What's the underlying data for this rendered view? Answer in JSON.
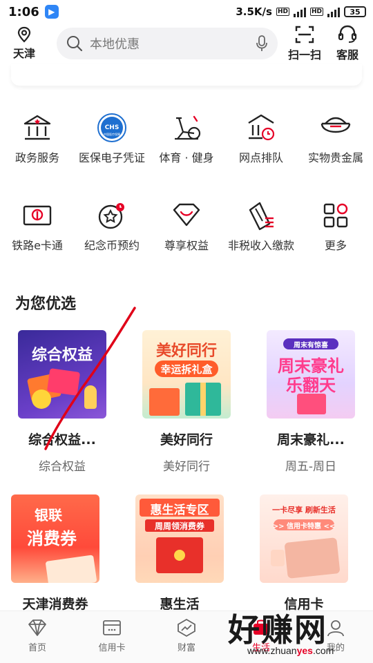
{
  "status_bar": {
    "time": "1:06",
    "speed": "3.5K/s",
    "battery": "35",
    "network": "4G"
  },
  "header": {
    "location": "天津",
    "search_placeholder": "本地优惠",
    "scan_label": "扫一扫",
    "service_label": "客服"
  },
  "services": [
    {
      "label": "政务服务",
      "icon": "government-building-icon"
    },
    {
      "label": "医保电子凭证",
      "icon": "chs-medical-insurance-icon"
    },
    {
      "label": "体育 · 健身",
      "icon": "exercise-bike-icon"
    },
    {
      "label": "网点排队",
      "icon": "branch-queue-icon"
    },
    {
      "label": "实物贵金属",
      "icon": "gold-ingot-icon"
    },
    {
      "label": "铁路e卡通",
      "icon": "railway-card-icon"
    },
    {
      "label": "纪念币预约",
      "icon": "commemorative-coin-icon"
    },
    {
      "label": "尊享权益",
      "icon": "diamond-privilege-icon"
    },
    {
      "label": "非税收入缴款",
      "icon": "tax-payment-icon"
    },
    {
      "label": "更多",
      "icon": "more-grid-icon"
    }
  ],
  "section_title": "为您优选",
  "featured": [
    {
      "title": "综合权益...",
      "sub": "综合权益",
      "thumb_text": "综合权益"
    },
    {
      "title": "美好同行",
      "sub": "美好同行",
      "thumb_text": "美好同行",
      "thumb_sub": "幸运拆礼盒"
    },
    {
      "title": "周末豪礼...",
      "sub": "周五-周日",
      "thumb_text": "周末豪礼",
      "thumb_text2": "乐翻天",
      "thumb_tag": "周末有惊喜"
    }
  ],
  "featured2": [
    {
      "title": "天津消费券",
      "thumb_text": "银联",
      "thumb_text2": "消费券"
    },
    {
      "title": "惠生活",
      "thumb_text": "惠生活专区",
      "thumb_sub": "周周领消费券"
    },
    {
      "title": "信用卡",
      "thumb_text": "一卡尽享 刷新生活",
      "thumb_sub": ">> 信用卡特惠 <<"
    }
  ],
  "bottom_nav": [
    {
      "label": "首页",
      "icon": "home-diamond-icon"
    },
    {
      "label": "信用卡",
      "icon": "credit-card-icon"
    },
    {
      "label": "财富",
      "icon": "wealth-chart-icon"
    },
    {
      "label": "生活",
      "icon": "life-icon",
      "active": true
    },
    {
      "label": "我的",
      "icon": "profile-icon"
    }
  ],
  "watermark": {
    "big": "好赚网",
    "url_pre": "www.zhuan",
    "url_mid": "yes",
    "url_post": ".com"
  },
  "colors": {
    "accent": "#e60026",
    "icon_stroke": "#222222"
  }
}
